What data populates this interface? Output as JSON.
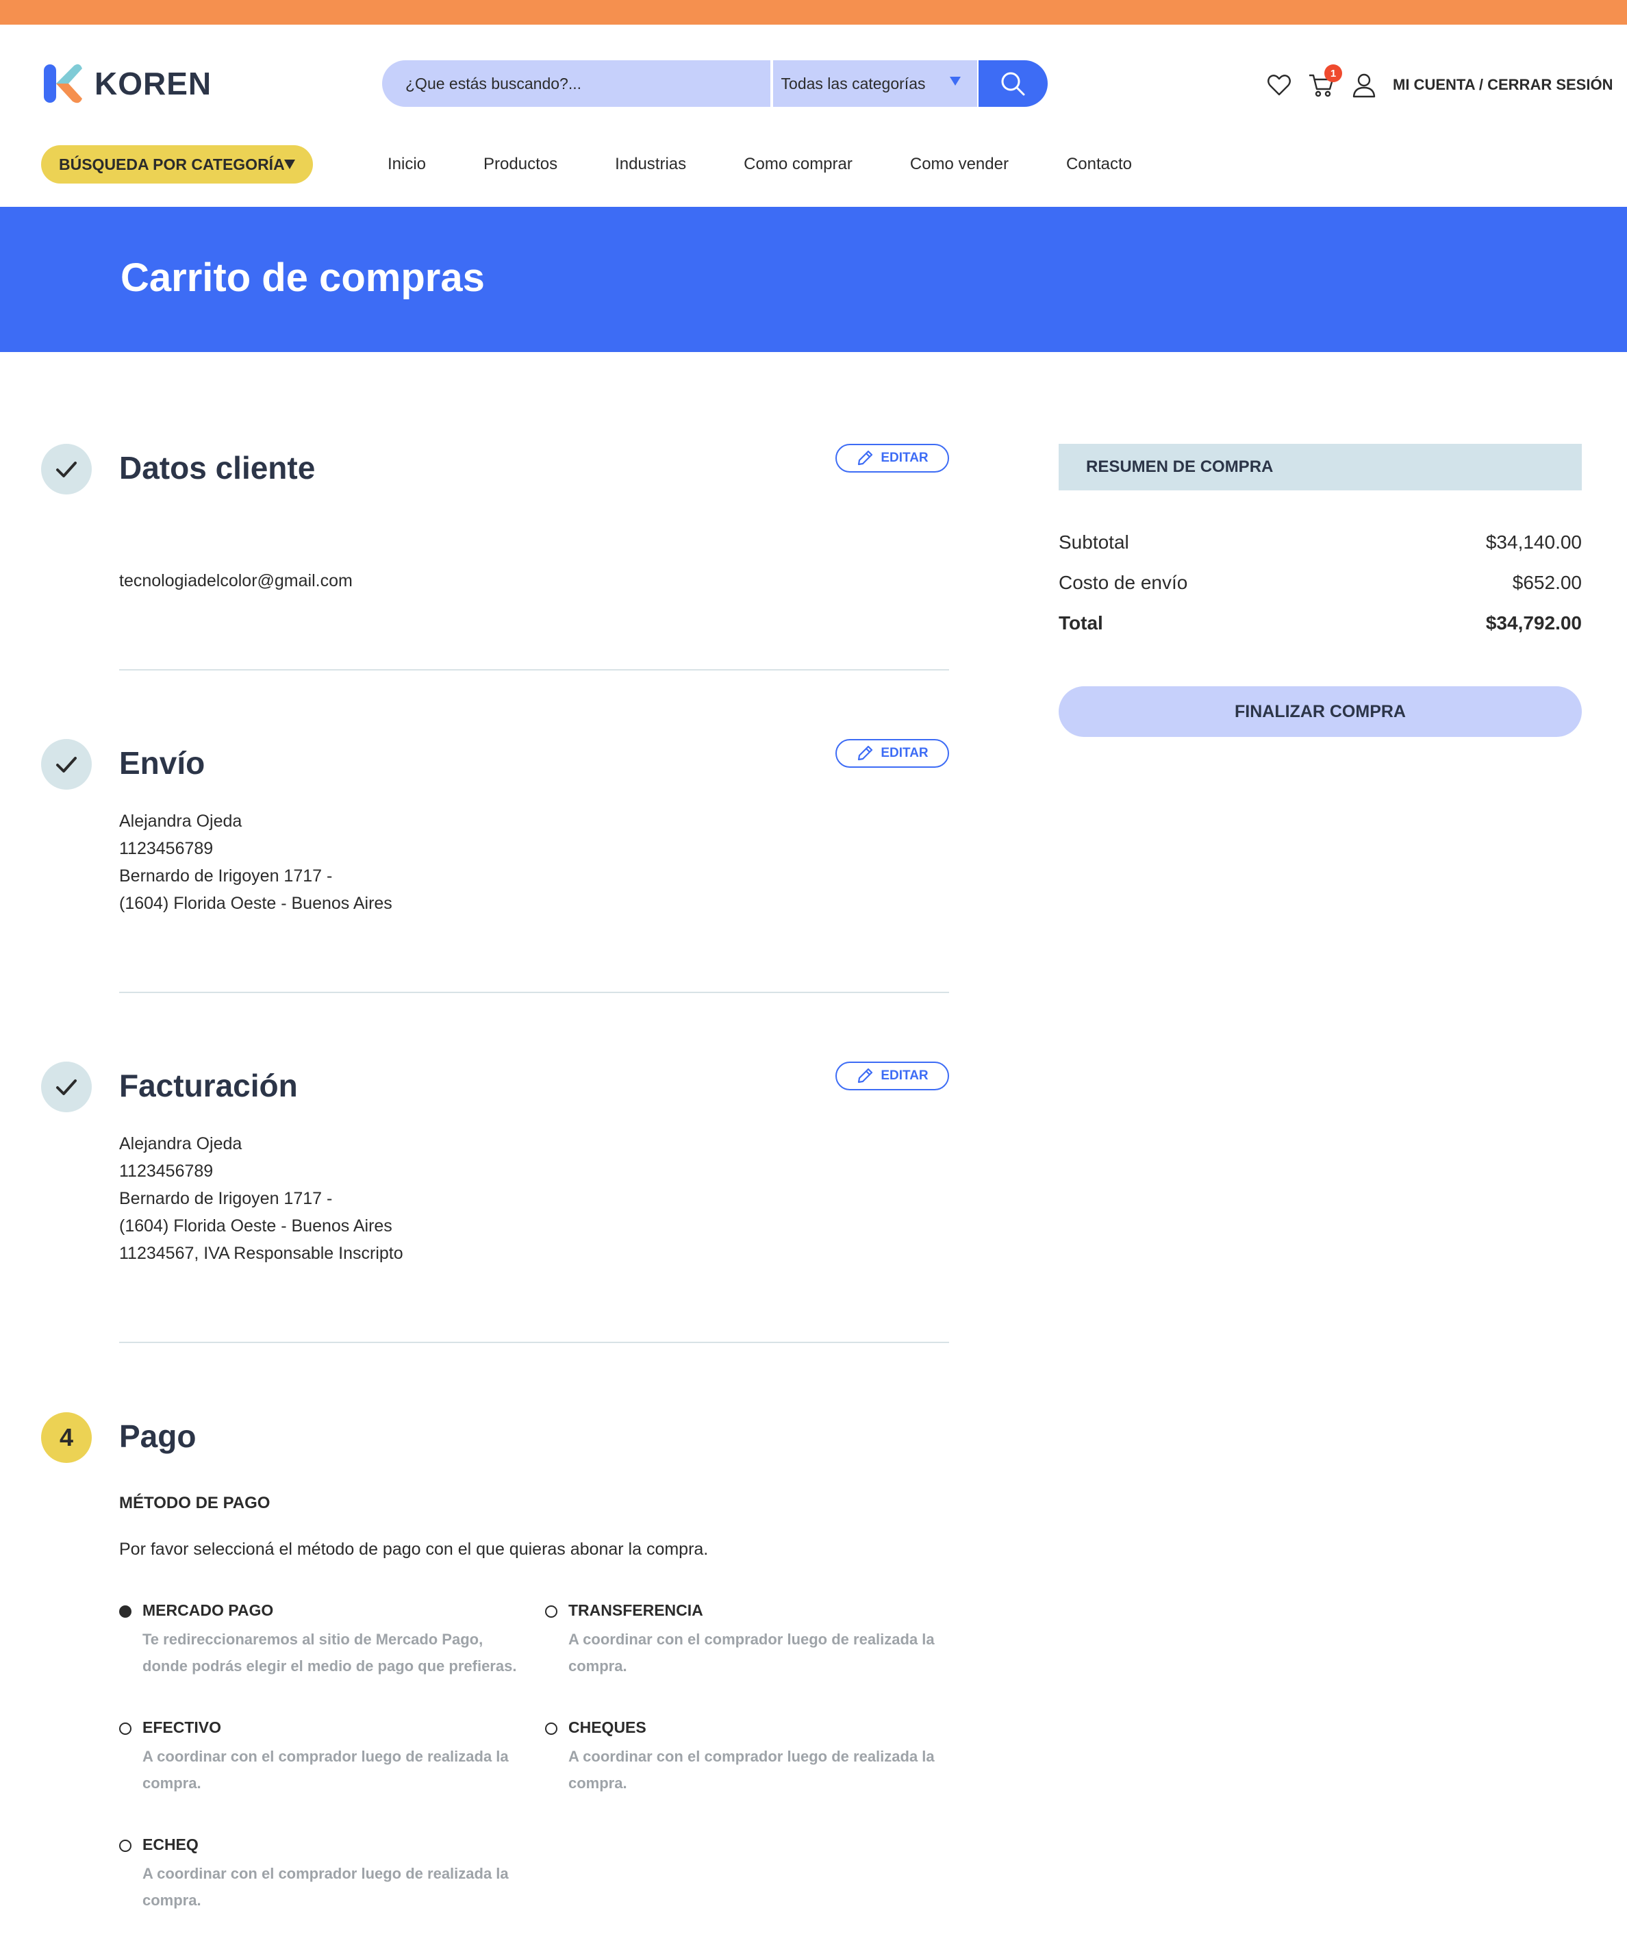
{
  "brand": {
    "name": "KOREN"
  },
  "search": {
    "placeholder": "¿Que estás buscando?...",
    "category": "Todas las categorías"
  },
  "header": {
    "cart_count": "1",
    "account": "MI CUENTA / CERRAR SESIÓN",
    "category_button": "BÚSQUEDA POR CATEGORÍA"
  },
  "nav": {
    "items": [
      "Inicio",
      "Productos",
      "Industrias",
      "Como comprar",
      "Como vender",
      "Contacto"
    ]
  },
  "page": {
    "title": "Carrito de compras"
  },
  "edit_label": "EDITAR",
  "steps": {
    "cliente": {
      "title": "Datos cliente",
      "lines": [
        "tecnologiadelcolor@gmail.com"
      ]
    },
    "envio": {
      "title": "Envío",
      "lines": [
        "Alejandra Ojeda",
        "1123456789",
        "Bernardo de Irigoyen 1717 -",
        "(1604) Florida Oeste - Buenos Aires"
      ]
    },
    "facturacion": {
      "title": "Facturación",
      "lines": [
        "Alejandra Ojeda",
        "1123456789",
        "Bernardo de Irigoyen 1717 -",
        "(1604) Florida Oeste - Buenos Aires",
        "11234567, IVA Responsable Inscripto"
      ]
    },
    "pago": {
      "number": "4",
      "title": "Pago",
      "method_label": "MÉTODO DE PAGO",
      "description": "Por favor seleccioná el método de pago con el que quieras abonar la compra."
    }
  },
  "payment_options": [
    {
      "name": "MERCADO PAGO",
      "desc": "Te redireccionaremos al sitio de Mercado Pago, donde podrás elegir el medio de pago que prefieras.",
      "selected": true
    },
    {
      "name": "TRANSFERENCIA",
      "desc": "A coordinar con el comprador luego de realizada la compra.",
      "selected": false
    },
    {
      "name": "EFECTIVO",
      "desc": "A coordinar con el comprador luego de realizada la compra.",
      "selected": false
    },
    {
      "name": "CHEQUES",
      "desc": "A coordinar con el comprador luego de realizada la compra.",
      "selected": false
    },
    {
      "name": "ECHEQ",
      "desc": "A coordinar con el comprador luego de realizada la compra.",
      "selected": false
    }
  ],
  "summary": {
    "title": "RESUMEN DE COMPRA",
    "subtotal_label": "Subtotal",
    "subtotal": "$34,140.00",
    "shipping_label": "Costo de envío",
    "shipping": "$652.00",
    "total_label": "Total",
    "total": "$34,792.00",
    "checkout": "FINALIZAR COMPRA"
  },
  "colors": {
    "accent": "#3d6cf5",
    "topbar": "#f5904f",
    "yellow": "#ecd254",
    "light_blue": "#c6d0fb"
  }
}
